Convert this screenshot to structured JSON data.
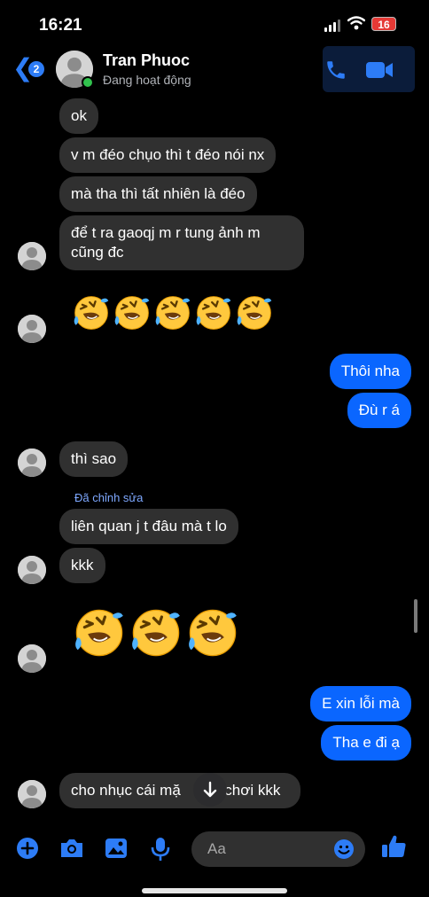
{
  "status_bar": {
    "time": "16:21",
    "battery": "16"
  },
  "header": {
    "back_badge": "2",
    "contact_name": "Tran Phuoc",
    "contact_status": "Đang hoạt động",
    "accent_color": "#2d7cf6"
  },
  "messages": [
    {
      "text": "ok"
    },
    {
      "text": "v m đéo chụo thì t đéo nói nx"
    },
    {
      "text": "mà tha thì tất nhiên là đéo"
    },
    {
      "text": "để t ra gaoqj m r tung ảnh m cũng đc"
    },
    {
      "text": "Thôi nha"
    },
    {
      "text": "Đù r á"
    },
    {
      "text": "thì sao"
    },
    {
      "edited_label": "Đã chỉnh sửa",
      "text": "liên quan j t đâu mà t lo"
    },
    {
      "text": "kkk"
    },
    {
      "text": "E xin lỗi mà"
    },
    {
      "text": "Tha e đi ạ"
    },
    {
      "text_left": "cho nhục cái mặ",
      "text_right": "chơi kkk"
    }
  ],
  "emoji_reactions": [
    {
      "emoji": "rolling-on-floor-laughing",
      "count": 5
    },
    {
      "emoji": "rolling-on-floor-laughing",
      "count": 3
    }
  ],
  "composer": {
    "placeholder": "Aa"
  },
  "colors": {
    "sent_bubble": "#0a66ff",
    "received_bubble": "#303030",
    "background": "#000000"
  }
}
